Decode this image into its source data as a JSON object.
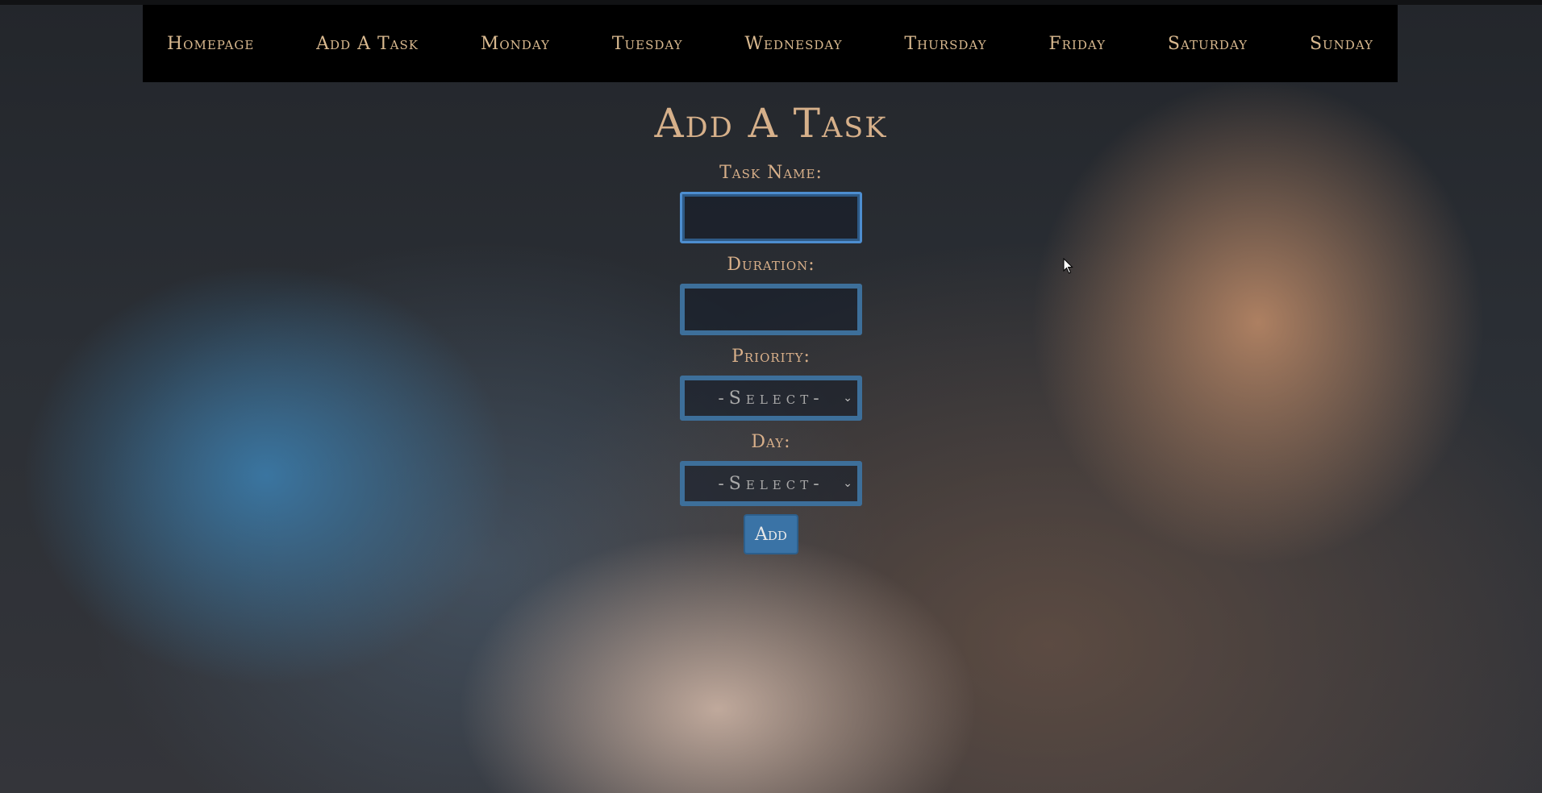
{
  "nav": {
    "items": [
      {
        "id": "homepage",
        "label": "Homepage"
      },
      {
        "id": "add-a-task",
        "label": "Add A Task"
      },
      {
        "id": "monday",
        "label": "Monday"
      },
      {
        "id": "tuesday",
        "label": "Tuesday"
      },
      {
        "id": "wednesday",
        "label": "Wednesday"
      },
      {
        "id": "thursday",
        "label": "Thursday"
      },
      {
        "id": "friday",
        "label": "Friday"
      },
      {
        "id": "saturday",
        "label": "Saturday"
      },
      {
        "id": "sunday",
        "label": "Sunday"
      }
    ]
  },
  "form": {
    "title": "Add A Task",
    "task_name_label": "Task Name:",
    "task_name_value": "",
    "duration_label": "Duration:",
    "duration_value": "",
    "priority_label": "Priority:",
    "priority_selected": "-Select-",
    "day_label": "Day:",
    "day_selected": "-Select-",
    "add_label": "Add"
  },
  "colors": {
    "nav_background": "#000000",
    "nav_text": "#d9b98f",
    "title_text": "#d6b08a",
    "input_border": "#3d6f9a",
    "input_focus_border": "#4d8ed0",
    "button_background": "#3a73a6"
  },
  "icons": {
    "select_chevron": "chevron-down-icon",
    "cursor": "mouse-pointer-icon"
  }
}
